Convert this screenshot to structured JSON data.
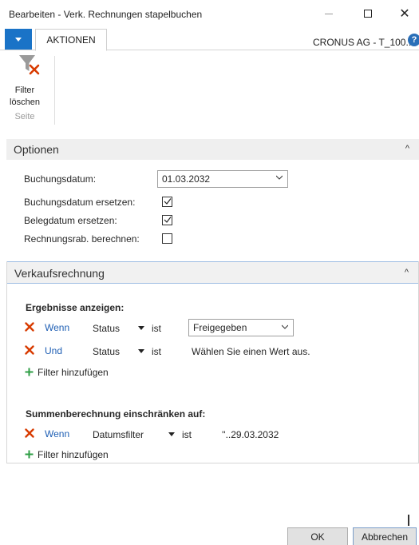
{
  "window": {
    "title": "Bearbeiten - Verk. Rechnungen stapelbuchen"
  },
  "ribbon": {
    "tab_label": "AKTIONEN",
    "company": "CRONUS AG - T_100...",
    "filter_button_line1": "Filter",
    "filter_button_line2": "löschen",
    "group_label": "Seite"
  },
  "options": {
    "header": "Optionen",
    "fields": {
      "posting_date_label": "Buchungsdatum:",
      "posting_date_value": "01.03.2032",
      "replace_posting_date_label": "Buchungsdatum ersetzen:",
      "replace_posting_date_checked": true,
      "replace_document_date_label": "Belegdatum ersetzen:",
      "replace_document_date_checked": true,
      "calc_invoice_discount_label": "Rechnungsrab. berechnen:",
      "calc_invoice_discount_checked": false
    }
  },
  "sales_invoice": {
    "header": "Verkaufsrechnung",
    "show_results_label": "Ergebnisse anzeigen:",
    "filters": [
      {
        "conjunction": "Wenn",
        "field": "Status",
        "operator": "ist",
        "value": "Freigegeben"
      },
      {
        "conjunction": "Und",
        "field": "Status",
        "operator": "ist",
        "value": "Wählen Sie einen Wert aus."
      }
    ],
    "add_filter_label": "Filter hinzufügen",
    "totals_label": "Summenberechnung einschränken auf:",
    "totals_filters": [
      {
        "conjunction": "Wenn",
        "field": "Datumsfilter",
        "operator": "ist",
        "value": "''..29.03.2032"
      }
    ],
    "add_totals_filter_label": "Filter hinzufügen"
  },
  "footer": {
    "ok_label": "OK",
    "cancel_label": "Abbrechen"
  },
  "colors": {
    "accent": "#1a73c7",
    "link": "#1f5fb4",
    "remove_red": "#d83b01",
    "add_green": "#2e9e44"
  },
  "icons": {
    "close": "close-icon",
    "help": "help-icon",
    "clear_filter": "clear-filter-icon",
    "remove": "remove-icon",
    "add": "plus-icon"
  }
}
